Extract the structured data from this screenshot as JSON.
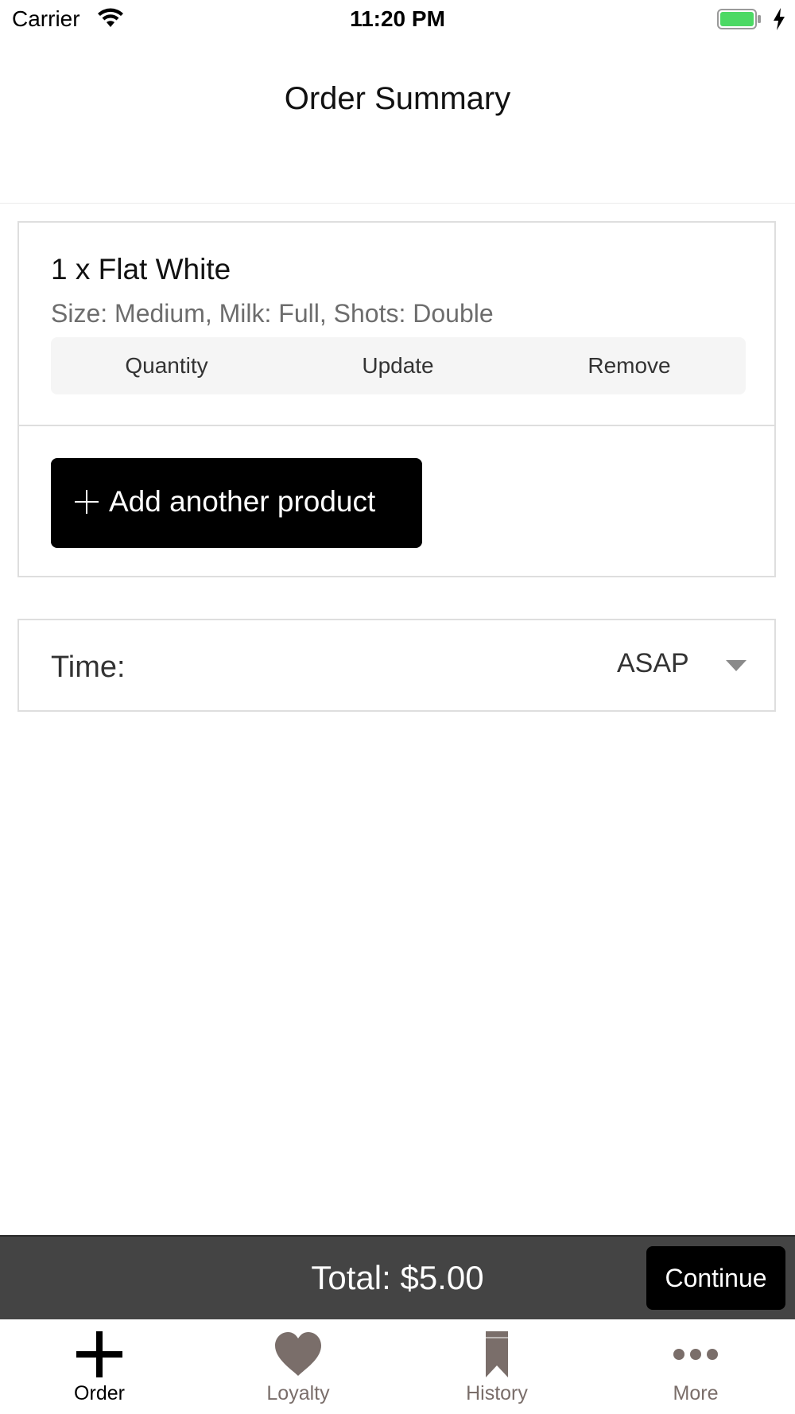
{
  "status_bar": {
    "carrier": "Carrier",
    "time": "11:20 PM",
    "battery_color": "#4cd964"
  },
  "header": {
    "title": "Order Summary"
  },
  "order": {
    "item": {
      "name": "1 x Flat White",
      "options": "Size: Medium, Milk: Full, Shots: Double"
    },
    "actions": {
      "quantity": "Quantity",
      "update": "Update",
      "remove": "Remove"
    },
    "add_product_label": "Add another product"
  },
  "time_selector": {
    "label": "Time:",
    "value": "ASAP"
  },
  "footer": {
    "total": "Total: $5.00",
    "continue_label": "Continue"
  },
  "tab_bar": {
    "tabs": [
      {
        "label": "Order",
        "icon": "plus-icon",
        "active": true
      },
      {
        "label": "Loyalty",
        "icon": "heart-icon",
        "active": false
      },
      {
        "label": "History",
        "icon": "bookmark-icon",
        "active": false
      },
      {
        "label": "More",
        "icon": "more-dots-icon",
        "active": false
      }
    ],
    "active_color": "#000000",
    "inactive_color": "#7a6e6a"
  }
}
